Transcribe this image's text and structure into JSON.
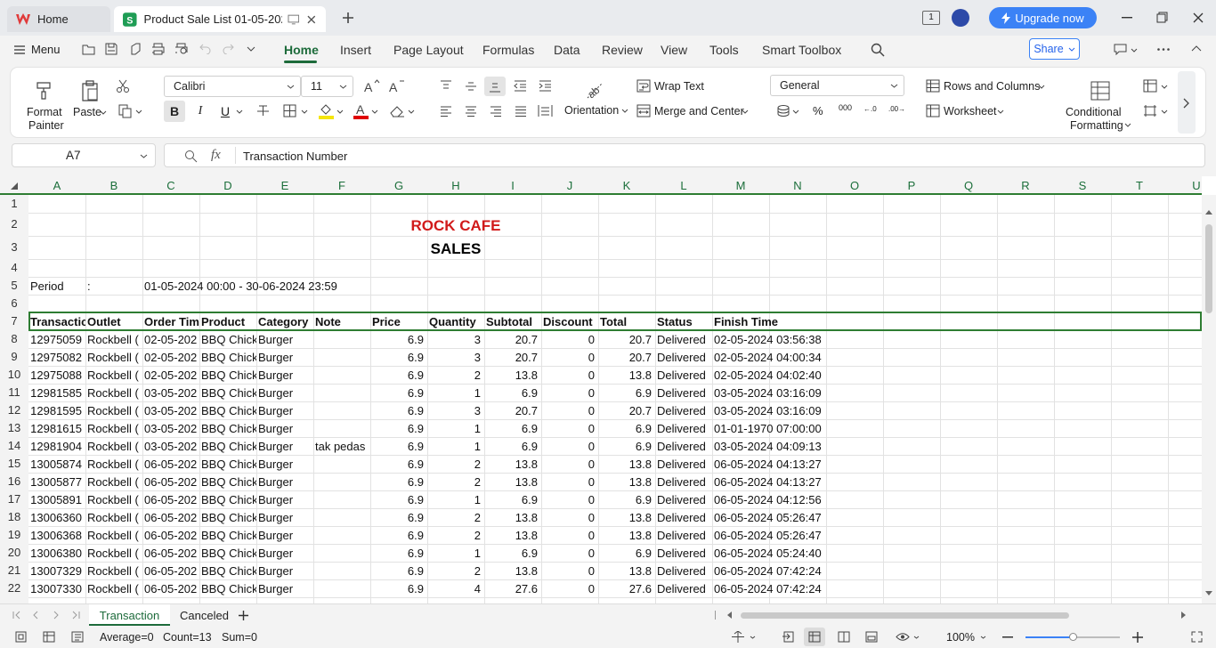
{
  "titlebar": {
    "home_tab": "Home",
    "doc_tab": "Product Sale List 01-05-2024 00",
    "upgrade": "Upgrade now",
    "page_badge": "1"
  },
  "menubar": {
    "menu": "Menu",
    "tabs": [
      "Home",
      "Insert",
      "Page Layout",
      "Formulas",
      "Data",
      "Review",
      "View",
      "Tools",
      "Smart Toolbox"
    ],
    "share": "Share"
  },
  "ribbon": {
    "format_painter_1": "Format",
    "format_painter_2": "Painter",
    "paste": "Paste",
    "font_name": "Calibri",
    "font_size": "11",
    "wrap_text": "Wrap Text",
    "merge_center": "Merge and Center",
    "orientation": "Orientation",
    "number_format": "General",
    "rows_columns": "Rows and Columns",
    "worksheet": "Worksheet",
    "conditional_1": "Conditional",
    "conditional_2": "Formatting",
    "bold": "B",
    "italic": "I",
    "underline": "U"
  },
  "formula": {
    "cell_ref": "A7",
    "fx": "fx",
    "content": "Transaction Number"
  },
  "columns": [
    "A",
    "B",
    "C",
    "D",
    "E",
    "F",
    "G",
    "H",
    "I",
    "J",
    "K",
    "L",
    "M",
    "N",
    "O",
    "P",
    "Q",
    "R",
    "S",
    "T",
    "U"
  ],
  "rows": [
    "1",
    "2",
    "3",
    "4",
    "5",
    "6",
    "7",
    "8",
    "9",
    "10",
    "11",
    "12",
    "13",
    "14",
    "15",
    "16",
    "17",
    "18",
    "19",
    "20",
    "21",
    "22"
  ],
  "sheet": {
    "title": "ROCK CAFE",
    "subtitle": "SALES",
    "period_label": "Period",
    "period_colon": ":",
    "period_value": "01-05-2024 00:00 - 30-06-2024 23:59",
    "headers": [
      "Transactic",
      "Outlet",
      "Order Tim",
      "Product",
      "Category",
      "Note",
      "Price",
      "Quantity",
      "Subtotal",
      "Discount",
      "Total",
      "Status",
      "Finish Time"
    ],
    "data": [
      [
        "12975059",
        "Rockbell (",
        "02-05-202",
        "BBQ Chick",
        "Burger",
        "",
        "6.9",
        "3",
        "20.7",
        "0",
        "20.7",
        "Delivered",
        "02-05-2024 03:56:38"
      ],
      [
        "12975082",
        "Rockbell (",
        "02-05-202",
        "BBQ Chick",
        "Burger",
        "",
        "6.9",
        "3",
        "20.7",
        "0",
        "20.7",
        "Delivered",
        "02-05-2024 04:00:34"
      ],
      [
        "12975088",
        "Rockbell (",
        "02-05-202",
        "BBQ Chick",
        "Burger",
        "",
        "6.9",
        "2",
        "13.8",
        "0",
        "13.8",
        "Delivered",
        "02-05-2024 04:02:40"
      ],
      [
        "12981585",
        "Rockbell (",
        "03-05-202",
        "BBQ Chick",
        "Burger",
        "",
        "6.9",
        "1",
        "6.9",
        "0",
        "6.9",
        "Delivered",
        "03-05-2024 03:16:09"
      ],
      [
        "12981595",
        "Rockbell (",
        "03-05-202",
        "BBQ Chick",
        "Burger",
        "",
        "6.9",
        "3",
        "20.7",
        "0",
        "20.7",
        "Delivered",
        "03-05-2024 03:16:09"
      ],
      [
        "12981615",
        "Rockbell (",
        "03-05-202",
        "BBQ Chick",
        "Burger",
        "",
        "6.9",
        "1",
        "6.9",
        "0",
        "6.9",
        "Delivered",
        "01-01-1970 07:00:00"
      ],
      [
        "12981904",
        "Rockbell (",
        "03-05-202",
        "BBQ Chick",
        "Burger",
        "tak pedas",
        "6.9",
        "1",
        "6.9",
        "0",
        "6.9",
        "Delivered",
        "03-05-2024 04:09:13"
      ],
      [
        "13005874",
        "Rockbell (",
        "06-05-202",
        "BBQ Chick",
        "Burger",
        "",
        "6.9",
        "2",
        "13.8",
        "0",
        "13.8",
        "Delivered",
        "06-05-2024 04:13:27"
      ],
      [
        "13005877",
        "Rockbell (",
        "06-05-202",
        "BBQ Chick",
        "Burger",
        "",
        "6.9",
        "2",
        "13.8",
        "0",
        "13.8",
        "Delivered",
        "06-05-2024 04:13:27"
      ],
      [
        "13005891",
        "Rockbell (",
        "06-05-202",
        "BBQ Chick",
        "Burger",
        "",
        "6.9",
        "1",
        "6.9",
        "0",
        "6.9",
        "Delivered",
        "06-05-2024 04:12:56"
      ],
      [
        "13006360",
        "Rockbell (",
        "06-05-202",
        "BBQ Chick",
        "Burger",
        "",
        "6.9",
        "2",
        "13.8",
        "0",
        "13.8",
        "Delivered",
        "06-05-2024 05:26:47"
      ],
      [
        "13006368",
        "Rockbell (",
        "06-05-202",
        "BBQ Chick",
        "Burger",
        "",
        "6.9",
        "2",
        "13.8",
        "0",
        "13.8",
        "Delivered",
        "06-05-2024 05:26:47"
      ],
      [
        "13006380",
        "Rockbell (",
        "06-05-202",
        "BBQ Chick",
        "Burger",
        "",
        "6.9",
        "1",
        "6.9",
        "0",
        "6.9",
        "Delivered",
        "06-05-2024 05:24:40"
      ],
      [
        "13007329",
        "Rockbell (",
        "06-05-202",
        "BBQ Chick",
        "Burger",
        "",
        "6.9",
        "2",
        "13.8",
        "0",
        "13.8",
        "Delivered",
        "06-05-2024 07:42:24"
      ],
      [
        "13007330",
        "Rockbell (",
        "06-05-202",
        "BBQ Chick",
        "Burger",
        "",
        "6.9",
        "4",
        "27.6",
        "0",
        "27.6",
        "Delivered",
        "06-05-2024 07:42:24"
      ]
    ]
  },
  "sheettabs": [
    "Transaction",
    "Canceled"
  ],
  "status": {
    "average": "Average=0",
    "count": "Count=13",
    "sum": "Sum=0",
    "zoom": "100%"
  },
  "colors": {
    "accent": "#1d6b3b",
    "title_red": "#d11a1a",
    "upgrade_bg": "#3b82f6"
  }
}
